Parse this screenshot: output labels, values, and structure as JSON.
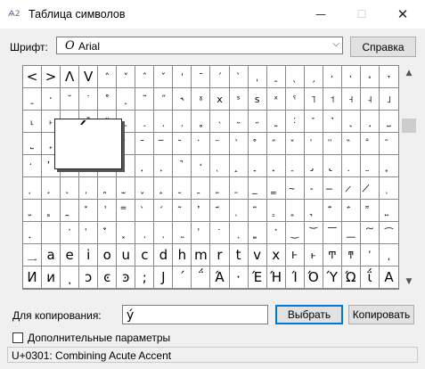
{
  "window": {
    "title": "Таблица символов",
    "title_icon": "charmap-app-icon"
  },
  "controls": {
    "minimize": "—",
    "maximize": "☐",
    "close": "✕"
  },
  "font": {
    "label": "Шрифт:",
    "value": "Arial",
    "icon_glyph": "O"
  },
  "help_button": "Справка",
  "grid": {
    "rows": [
      [
        "<",
        ">",
        "Λ",
        "V",
        "˄",
        "˅",
        "ˆ",
        "ˇ",
        "ˈ",
        "ˉ",
        "ˊ",
        "ˋ",
        "ˌ",
        "ˍ",
        "ˎ",
        "ˏ",
        "˒",
        "˓",
        "˔",
        "˕"
      ],
      [
        "ˍ",
        "ˑ",
        "˘",
        "˙",
        "˚",
        "˛",
        "˜",
        "˝",
        "˞",
        "ˠ",
        "x",
        "ˢ",
        "s",
        "ˣ",
        "ˤ",
        "˥",
        "˦",
        "˧",
        "˨",
        "˩"
      ],
      [
        "˪",
        "˫",
        "ˬ",
        "˭",
        "ˮ",
        "˯",
        "˰",
        "˱",
        "˲",
        "˳",
        "˴",
        "˵",
        "˶",
        "˷",
        "˸",
        "˹",
        "˺",
        "˻",
        "˼",
        "˽"
      ],
      [
        "˾",
        "˿",
        "̀",
        "́",
        "̂",
        "̃",
        "̄",
        "̅",
        "̆",
        "̇",
        "̈",
        "̉",
        "̊",
        "̋",
        "̌",
        "̍",
        "̎",
        "̏",
        "̐",
        "̑"
      ],
      [
        "̒",
        "̓",
        "̔",
        "̕",
        "̖",
        "̗",
        "̘",
        "̙",
        "̚",
        "̛",
        "̜",
        "̝",
        "̞",
        "̟",
        "̠",
        "̡",
        "̢",
        "̣",
        "̤",
        "̥"
      ],
      [
        "̦",
        "̧",
        "̨",
        "̩",
        "̪",
        "̫",
        "̬",
        "̭",
        "̮",
        "̯",
        "̰",
        "̱",
        "̲",
        "̳",
        "̴",
        "̵",
        "̶",
        "̷",
        "̸",
        "̹"
      ],
      [
        "̺",
        "̻",
        "̼",
        "̽",
        "̾",
        "̿",
        "̀",
        "́",
        "͂",
        "̓",
        "̈́",
        "ͅ",
        "͆",
        "͇",
        "͈",
        "͉",
        "͊",
        "͋",
        "͌",
        "͍"
      ],
      [
        "͎",
        "͏",
        "͐",
        "͑",
        "͒",
        "͓",
        "͔",
        "͕",
        "͖",
        "͗",
        "͘",
        "͙",
        "͚",
        "͛",
        "͜",
        "͝",
        "͞",
        "͟",
        "͠",
        "͡"
      ],
      [
        "͢",
        "a",
        "e",
        "i",
        "o",
        "u",
        "c",
        "d",
        "h",
        "m",
        "r",
        "t",
        "v",
        "x",
        "Ͱ",
        "ͱ",
        "Ͳ",
        "ͳ",
        "ʹ",
        "͵"
      ],
      [
        "Ͷ",
        "ͷ",
        "ͺ",
        "ͻ",
        "ͼ",
        "ͽ",
        ";",
        "Ϳ",
        "΄",
        "΅",
        "Ά",
        "·",
        "Έ",
        "Ή",
        "Ί",
        "Ό",
        "Ύ",
        "Ώ",
        "ΐ",
        "Α"
      ]
    ]
  },
  "zoom_glyph": "́",
  "copy": {
    "label": "Для копирования:",
    "value": "ý"
  },
  "select_button": "Выбрать",
  "copy_button": "Копировать",
  "advanced": {
    "label": "Дополнительные параметры",
    "checked": false
  },
  "status": "U+0301: Combining Acute Accent",
  "scrollbar": {
    "up": "▲",
    "down": "▼"
  }
}
